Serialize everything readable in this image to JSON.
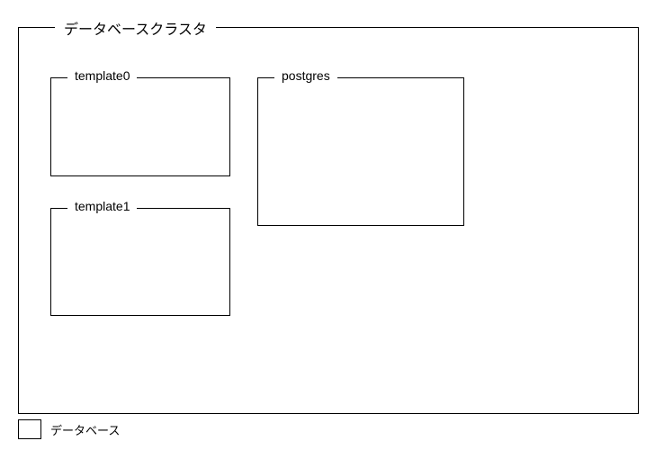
{
  "cluster": {
    "title": "データベースクラスタ",
    "databases": [
      {
        "name": "template0",
        "class": "box-template0"
      },
      {
        "name": "template1",
        "class": "box-template1"
      },
      {
        "name": "postgres",
        "class": "box-postgres"
      }
    ]
  },
  "legend": {
    "label": "データベース"
  }
}
